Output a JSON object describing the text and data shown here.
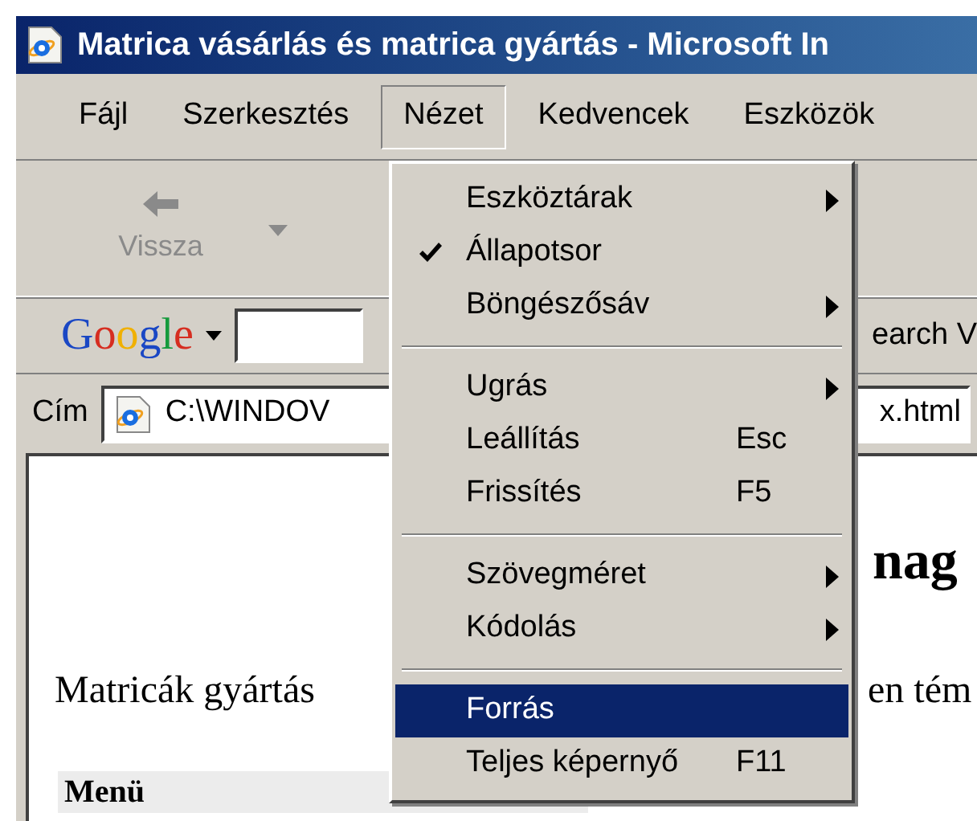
{
  "window": {
    "title": "Matrica vásárlás és matrica gyártás - Microsoft In"
  },
  "menu_bar": [
    {
      "label": "Fájl",
      "selected": false
    },
    {
      "label": "Szerkesztés",
      "selected": false
    },
    {
      "label": "Nézet",
      "selected": true
    },
    {
      "label": "Kedvencek",
      "selected": false
    },
    {
      "label": "Eszközök",
      "selected": false
    }
  ],
  "toolbar": {
    "back_button": {
      "label": "Vissza",
      "disabled": true
    }
  },
  "google_bar": {
    "logo": "Google",
    "search_fragment": "earch V"
  },
  "address_bar": {
    "label": "Cím",
    "value_start": "C:\\WINDOV",
    "value_end": "x.html"
  },
  "view_menu": [
    {
      "kind": "item",
      "label": "Eszköztárak",
      "submenu": true,
      "checked": false,
      "selected": false
    },
    {
      "kind": "item",
      "label": "Állapotsor",
      "submenu": false,
      "checked": true,
      "selected": false
    },
    {
      "kind": "item",
      "label": "Böngészősáv",
      "submenu": true,
      "checked": false,
      "selected": false
    },
    {
      "kind": "separator"
    },
    {
      "kind": "item",
      "label": "Ugrás",
      "submenu": true,
      "checked": false,
      "selected": false
    },
    {
      "kind": "item",
      "label": "Leállítás",
      "shortcut": "Esc",
      "submenu": false,
      "checked": false,
      "selected": false
    },
    {
      "kind": "item",
      "label": "Frissítés",
      "shortcut": "F5",
      "submenu": false,
      "checked": false,
      "selected": false
    },
    {
      "kind": "separator"
    },
    {
      "kind": "item",
      "label": "Szövegméret",
      "submenu": true,
      "checked": false,
      "selected": false
    },
    {
      "kind": "item",
      "label": "Kódolás",
      "submenu": true,
      "checked": false,
      "selected": false
    },
    {
      "kind": "separator"
    },
    {
      "kind": "item",
      "label": "Forrás",
      "submenu": false,
      "checked": false,
      "selected": true
    },
    {
      "kind": "item",
      "label": "Teljes képernyő",
      "shortcut": "F11",
      "submenu": false,
      "checked": false,
      "selected": false
    }
  ],
  "page": {
    "heading_fragment": "nag",
    "paragraph_start": "Matricák gyártás",
    "paragraph_end": "en tém",
    "menu_heading": "Menü"
  }
}
